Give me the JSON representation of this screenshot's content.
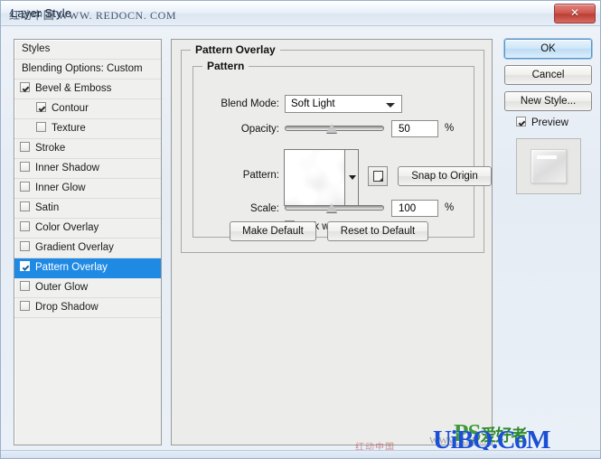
{
  "window": {
    "title": "Layer Style",
    "title_watermark": "红动中国 WWW. REDOCN. COM",
    "close_glyph": "✕"
  },
  "styles_panel": {
    "header": "Styles",
    "blending_options": "Blending Options: Custom",
    "items": [
      {
        "label": "Bevel & Emboss",
        "checked": true,
        "indent": false,
        "selected": false
      },
      {
        "label": "Contour",
        "checked": true,
        "indent": true,
        "selected": false
      },
      {
        "label": "Texture",
        "checked": false,
        "indent": true,
        "selected": false
      },
      {
        "label": "Stroke",
        "checked": false,
        "indent": false,
        "selected": false
      },
      {
        "label": "Inner Shadow",
        "checked": false,
        "indent": false,
        "selected": false
      },
      {
        "label": "Inner Glow",
        "checked": false,
        "indent": false,
        "selected": false
      },
      {
        "label": "Satin",
        "checked": false,
        "indent": false,
        "selected": false
      },
      {
        "label": "Color Overlay",
        "checked": false,
        "indent": false,
        "selected": false
      },
      {
        "label": "Gradient Overlay",
        "checked": false,
        "indent": false,
        "selected": false
      },
      {
        "label": "Pattern Overlay",
        "checked": true,
        "indent": false,
        "selected": true
      },
      {
        "label": "Outer Glow",
        "checked": false,
        "indent": false,
        "selected": false
      },
      {
        "label": "Drop Shadow",
        "checked": false,
        "indent": false,
        "selected": false
      }
    ],
    "selection_color": "#1f8ae4"
  },
  "main": {
    "group_title": "Pattern Overlay",
    "subgroup_title": "Pattern",
    "blend_mode": {
      "label": "Blend Mode:",
      "value": "Soft Light"
    },
    "opacity": {
      "label": "Opacity:",
      "value": "50",
      "unit": "%",
      "percent": 47
    },
    "pattern": {
      "label": "Pattern:",
      "new_pattern_icon": "new-pattern-icon",
      "dropdown_icon": "chevron-down-icon",
      "snap_button": "Snap to Origin"
    },
    "scale": {
      "label": "Scale:",
      "value": "100",
      "unit": "%",
      "percent": 47
    },
    "link_with_layer": {
      "label": "Link with Layer",
      "checked": true
    },
    "make_default": "Make Default",
    "reset_to_default": "Reset to Default"
  },
  "actions": {
    "ok": "OK",
    "cancel": "Cancel",
    "new_style": "New Style...",
    "preview": {
      "label": "Preview",
      "checked": true
    }
  },
  "watermarks": {
    "ps_logo": "PS",
    "ps_cn": "爱好者",
    "uibq": "UiBQ.CoM",
    "red_text": "红动中国",
    "small_cn": "WWW.RED..."
  }
}
